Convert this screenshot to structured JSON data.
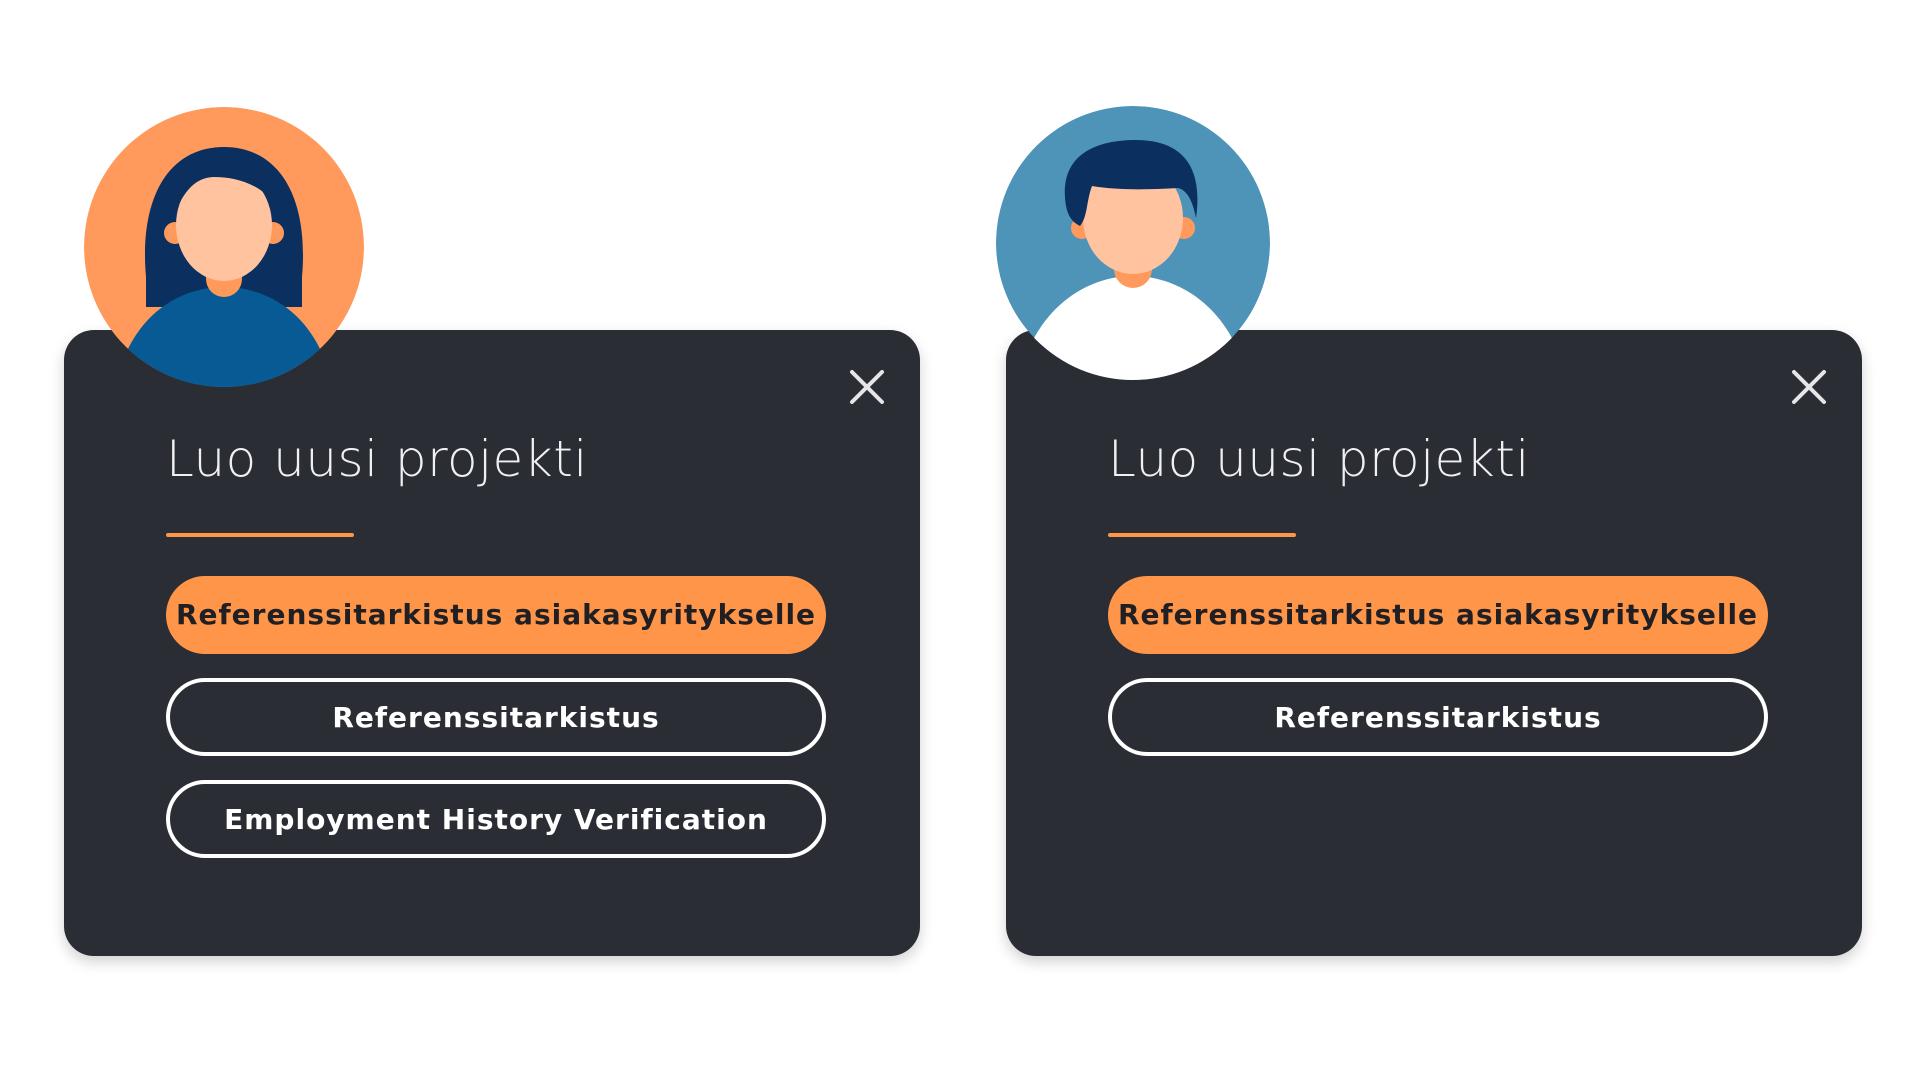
{
  "dialogs": [
    {
      "title": "Luo uusi projekti",
      "avatar": {
        "icon": "female-user-avatar-icon",
        "bg_color": "#ff9a5c"
      },
      "close_icon": "close-icon",
      "options": [
        {
          "label": "Referenssitarkistus asiakasyritykselle",
          "style": "primary"
        },
        {
          "label": "Referenssitarkistus",
          "style": "outline"
        },
        {
          "label": "Employment History Verification",
          "style": "outline"
        }
      ]
    },
    {
      "title": "Luo uusi projekti",
      "avatar": {
        "icon": "male-user-avatar-icon",
        "bg_color": "#4e93b8"
      },
      "close_icon": "close-icon",
      "options": [
        {
          "label": "Referenssitarkistus asiakasyritykselle",
          "style": "primary"
        },
        {
          "label": "Referenssitarkistus",
          "style": "outline"
        }
      ]
    }
  ],
  "colors": {
    "dialog_bg": "#2b2d34",
    "accent": "#ff9548",
    "text_light": "#f0f0f2"
  }
}
